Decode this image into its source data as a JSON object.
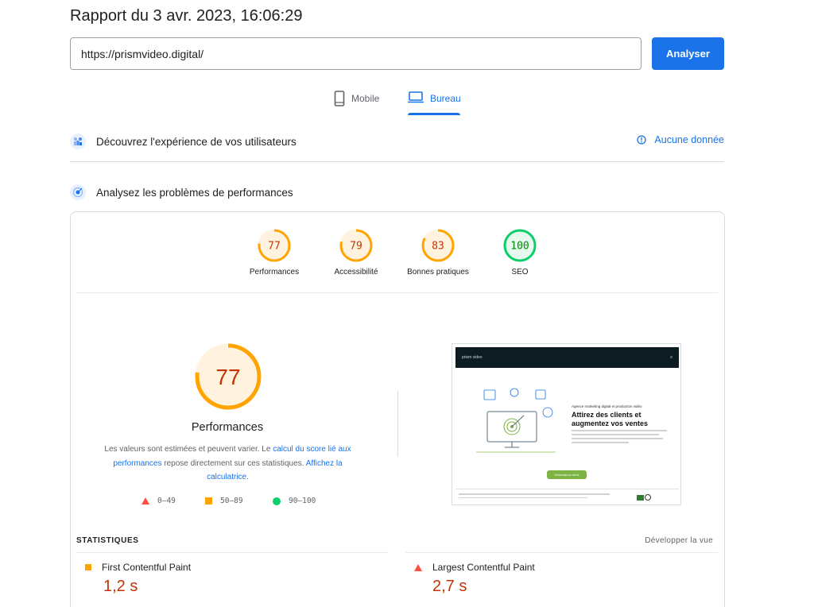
{
  "header": {
    "title": "Rapport du 3 avr. 2023, 16:06:29",
    "url_value": "https://prismvideo.digital/",
    "analyze_label": "Analyser"
  },
  "tabs": [
    {
      "label": "Mobile",
      "icon": "smartphone-icon",
      "active": false
    },
    {
      "label": "Bureau",
      "icon": "laptop-icon",
      "active": true
    }
  ],
  "experience": {
    "label": "Découvrez l'expérience de vos utilisateurs",
    "no_data_label": "Aucune donnée"
  },
  "analysis": {
    "label": "Analysez les problèmes de performances"
  },
  "categories": [
    {
      "label": "Performances",
      "score": 77,
      "color": "#ffa400",
      "text_color": "#c33300"
    },
    {
      "label": "Accessibilité",
      "score": 79,
      "color": "#ffa400",
      "text_color": "#c33300"
    },
    {
      "label": "Bonnes pratiques",
      "score": 83,
      "color": "#ffa400",
      "text_color": "#c33300"
    },
    {
      "label": "SEO",
      "score": 100,
      "color": "#0cce6b",
      "text_color": "#008800"
    }
  ],
  "performance": {
    "score": 77,
    "title": "Performances",
    "desc_part1": "Les valeurs sont estimées et peuvent varier. Le ",
    "desc_link1": "calcul du score lié aux performances",
    "desc_part2": " repose directement sur ces statistiques. ",
    "desc_link2": "Affichez la calculatrice.",
    "legend": [
      {
        "range": "0–49",
        "shape": "triangle",
        "color": "#ff4e42"
      },
      {
        "range": "50–89",
        "shape": "square",
        "color": "#ffa400"
      },
      {
        "range": "90–100",
        "shape": "circle",
        "color": "#0cce6b"
      }
    ]
  },
  "screenshot": {
    "brand": "prism video",
    "subheading": "Agence marketing digital et production vidéo",
    "headline": "Attirez des clients et augmentez vos ventes",
    "cta": "Demandez un devis"
  },
  "stats": {
    "title": "STATISTIQUES",
    "expand_label": "Développer la vue",
    "metrics": [
      {
        "label": "First Contentful Paint",
        "value": "1,2 s",
        "rating": "average"
      },
      {
        "label": "Largest Contentful Paint",
        "value": "2,7 s",
        "rating": "fail"
      }
    ]
  }
}
